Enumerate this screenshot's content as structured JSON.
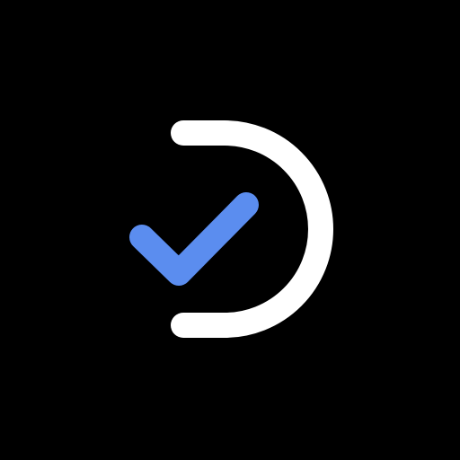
{
  "app_icon": {
    "icon_name": "check-d-logo-icon",
    "colors": {
      "background": "#000000",
      "d_stroke": "#FFFFFF",
      "check_stroke": "#5B8DEF"
    }
  }
}
